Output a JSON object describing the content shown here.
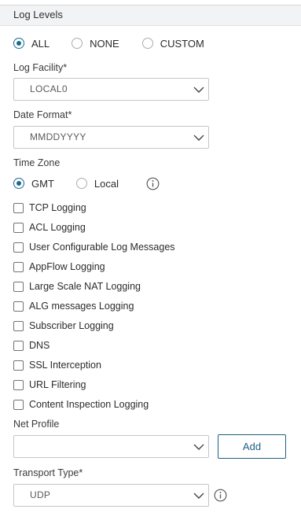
{
  "section": {
    "title": "Log Levels"
  },
  "log_levels": {
    "options": [
      {
        "label": "ALL",
        "selected": true
      },
      {
        "label": "NONE",
        "selected": false
      },
      {
        "label": "CUSTOM",
        "selected": false
      }
    ]
  },
  "log_facility": {
    "label": "Log Facility*",
    "value": "LOCAL0"
  },
  "date_format": {
    "label": "Date Format*",
    "value": "MMDDYYYY"
  },
  "time_zone": {
    "label": "Time Zone",
    "options": [
      {
        "label": "GMT",
        "selected": true
      },
      {
        "label": "Local",
        "selected": false
      }
    ],
    "info_icon": "info-icon"
  },
  "checkboxes": [
    {
      "label": "TCP Logging",
      "checked": false
    },
    {
      "label": "ACL Logging",
      "checked": false
    },
    {
      "label": "User Configurable Log Messages",
      "checked": false
    },
    {
      "label": "AppFlow Logging",
      "checked": false
    },
    {
      "label": "Large Scale NAT Logging",
      "checked": false
    },
    {
      "label": "ALG messages Logging",
      "checked": false
    },
    {
      "label": "Subscriber Logging",
      "checked": false
    },
    {
      "label": "DNS",
      "checked": false
    },
    {
      "label": "SSL Interception",
      "checked": false
    },
    {
      "label": "URL Filtering",
      "checked": false
    },
    {
      "label": "Content Inspection Logging",
      "checked": false
    }
  ],
  "net_profile": {
    "label": "Net Profile",
    "value": "",
    "add_label": "Add"
  },
  "transport_type": {
    "label": "Transport Type*",
    "value": "UDP",
    "info_icon": "info-icon"
  },
  "colors": {
    "accent": "#1a6a8c",
    "button_border": "#1f5f80",
    "header_bg": "#f2f3f5"
  }
}
